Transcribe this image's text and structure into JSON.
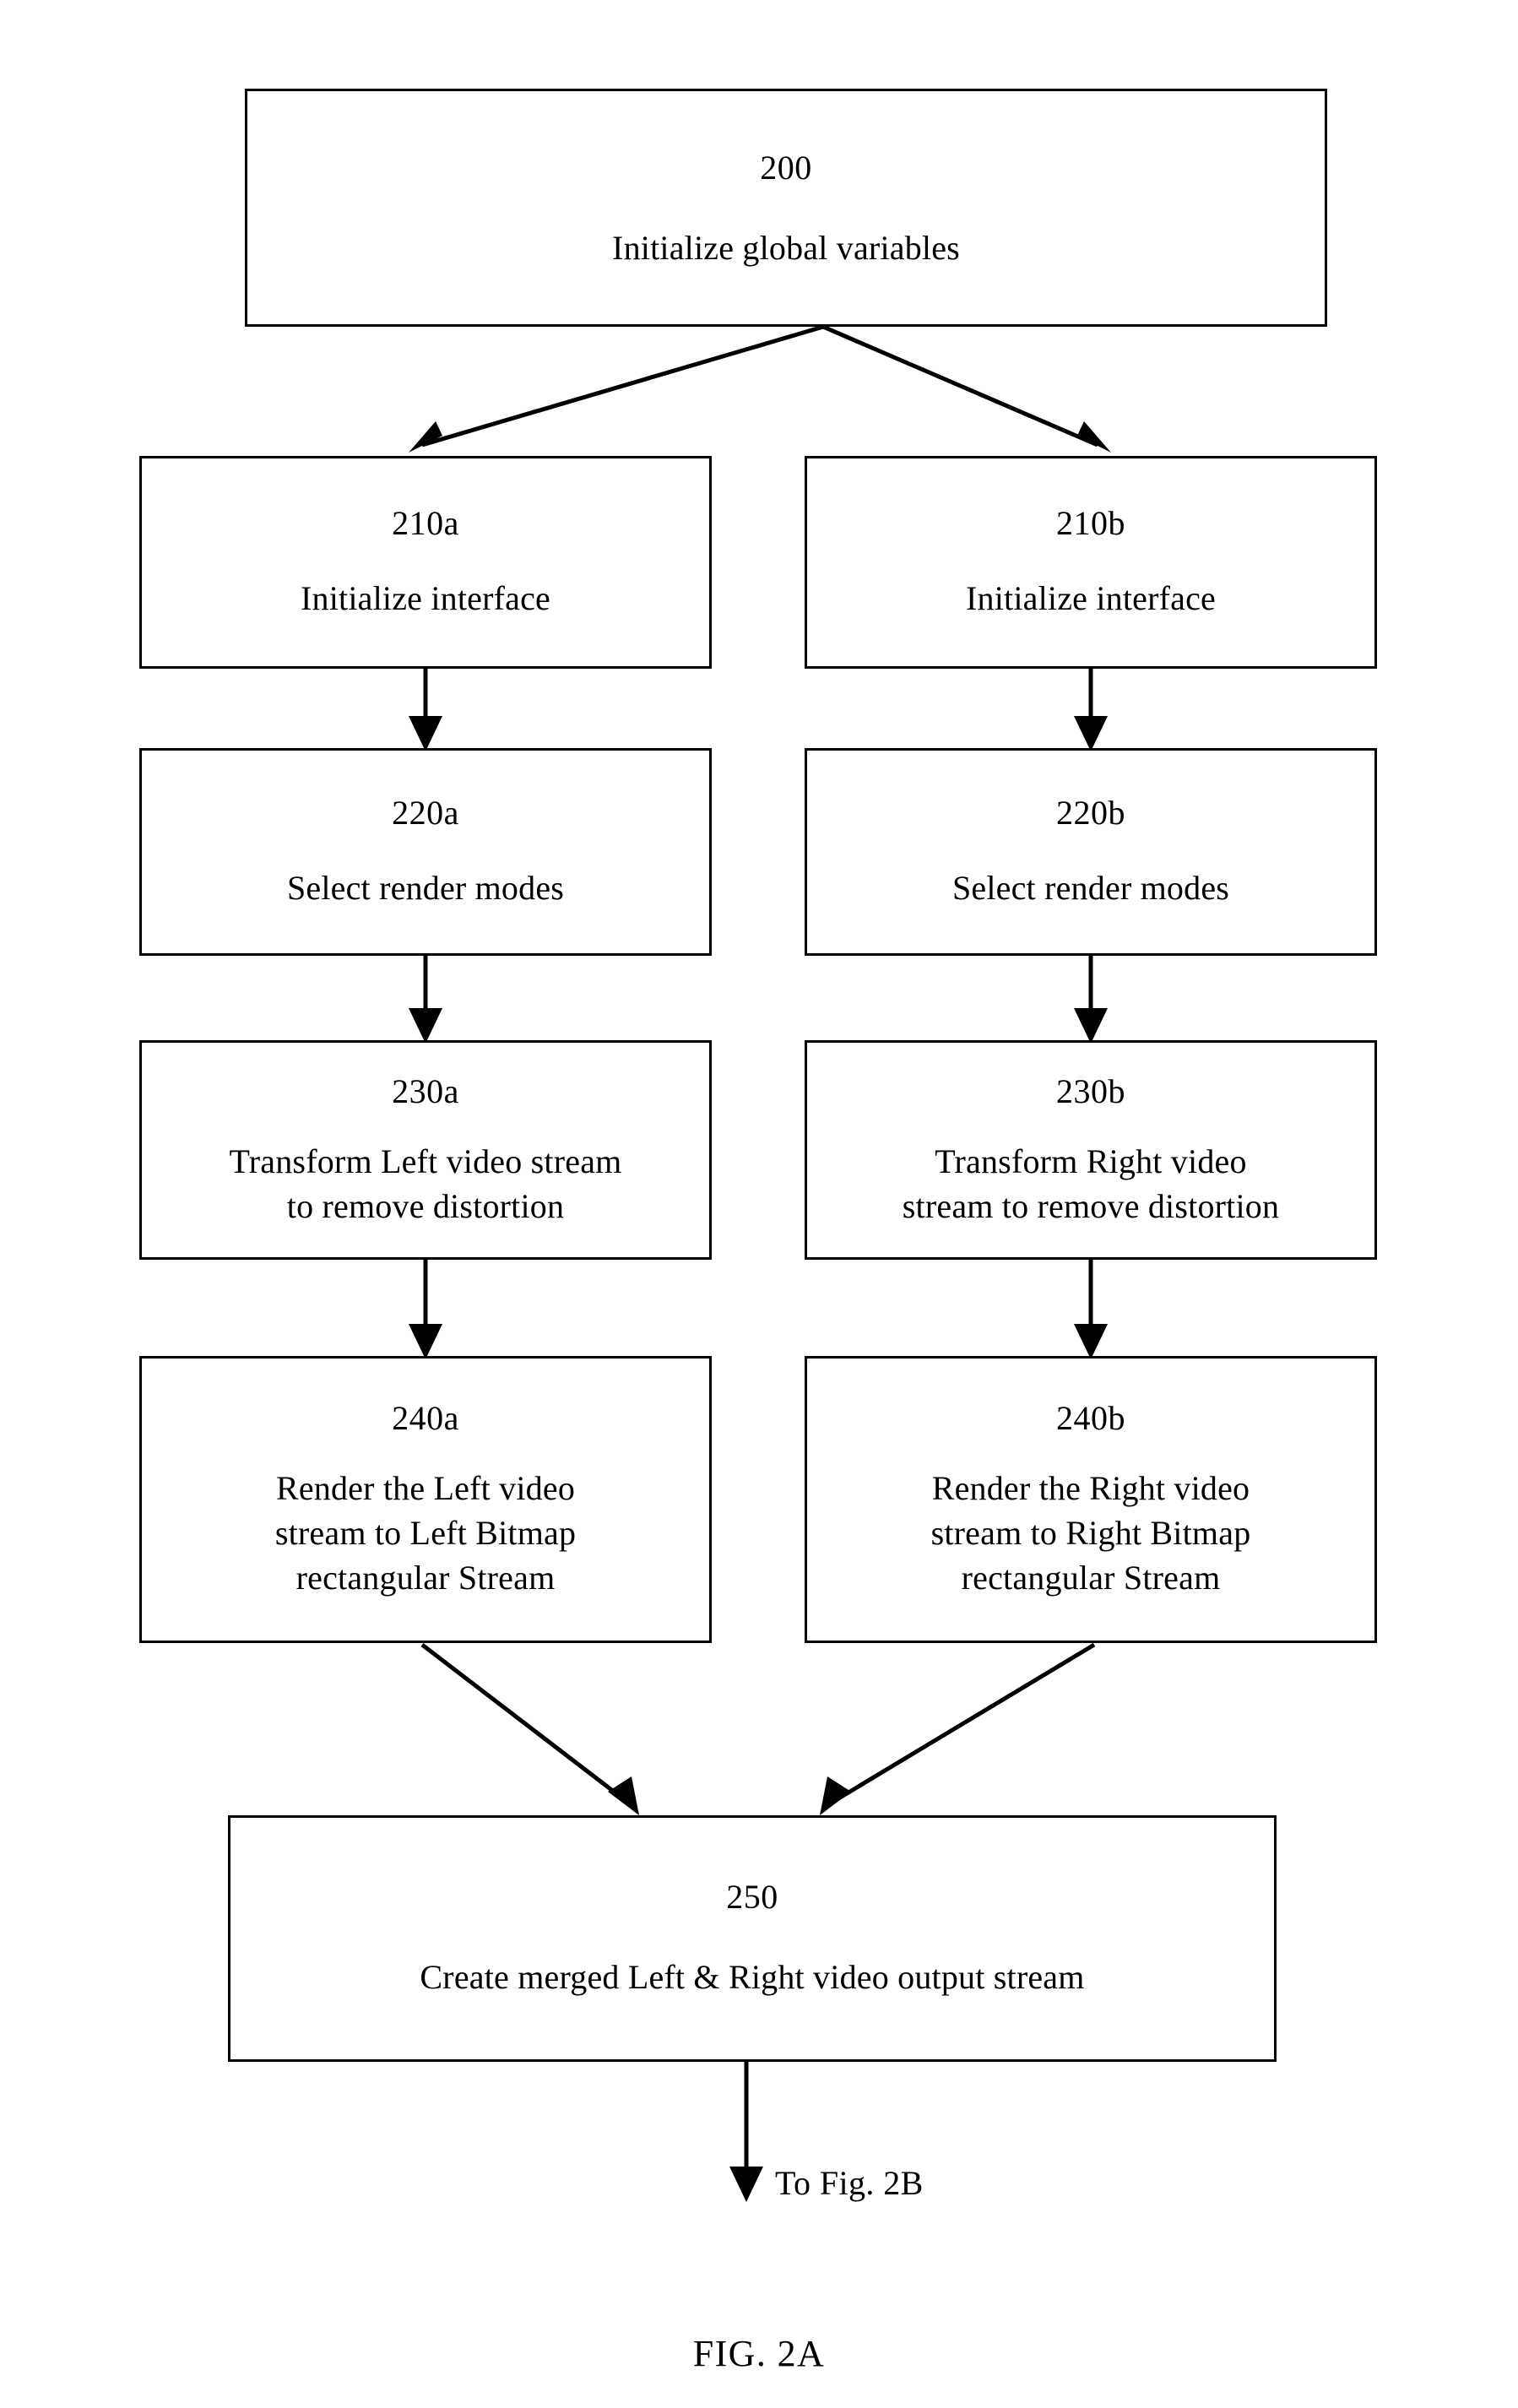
{
  "figure": {
    "caption": "FIG. 2A",
    "continuation_label": "To Fig. 2B"
  },
  "chart_data": {
    "type": "diagram",
    "subtype": "flowchart",
    "title": "FIG. 2A",
    "orientation": "top-to-bottom",
    "nodes": [
      {
        "id": "200",
        "ref": "200",
        "label": "Initialize global variables",
        "shape": "rectangle"
      },
      {
        "id": "210a",
        "ref": "210a",
        "label": "Initialize interface",
        "shape": "rectangle"
      },
      {
        "id": "210b",
        "ref": "210b",
        "label": "Initialize interface",
        "shape": "rectangle"
      },
      {
        "id": "220a",
        "ref": "220a",
        "label": "Select render modes",
        "shape": "rectangle"
      },
      {
        "id": "220b",
        "ref": "220b",
        "label": "Select render modes",
        "shape": "rectangle"
      },
      {
        "id": "230a",
        "ref": "230a",
        "label": "Transform Left video stream\nto remove distortion",
        "shape": "rectangle"
      },
      {
        "id": "230b",
        "ref": "230b",
        "label": "Transform Right video\nstream to remove distortion",
        "shape": "rectangle"
      },
      {
        "id": "240a",
        "ref": "240a",
        "label": "Render the Left video\nstream to Left Bitmap\nrectangular Stream",
        "shape": "rectangle"
      },
      {
        "id": "240b",
        "ref": "240b",
        "label": "Render the Right video\nstream to Right Bitmap\nrectangular Stream",
        "shape": "rectangle"
      },
      {
        "id": "250",
        "ref": "250",
        "label": "Create merged Left & Right video output stream",
        "shape": "rectangle"
      }
    ],
    "edges": [
      {
        "from": "200",
        "to": "210a",
        "style": "solid-arrow"
      },
      {
        "from": "200",
        "to": "210b",
        "style": "solid-arrow"
      },
      {
        "from": "210a",
        "to": "220a",
        "style": "solid-arrow"
      },
      {
        "from": "210b",
        "to": "220b",
        "style": "solid-arrow"
      },
      {
        "from": "220a",
        "to": "230a",
        "style": "solid-arrow"
      },
      {
        "from": "220b",
        "to": "230b",
        "style": "solid-arrow"
      },
      {
        "from": "230a",
        "to": "240a",
        "style": "solid-arrow"
      },
      {
        "from": "230b",
        "to": "240b",
        "style": "solid-arrow"
      },
      {
        "from": "240a",
        "to": "250",
        "style": "solid-arrow"
      },
      {
        "from": "240b",
        "to": "250",
        "style": "solid-arrow"
      },
      {
        "from": "250",
        "to": "To Fig. 2B",
        "style": "solid-arrow"
      }
    ],
    "colors": {
      "line": "#000000",
      "fill": "#ffffff",
      "text": "#000000"
    }
  },
  "nodes": {
    "n200": {
      "ref": "200",
      "label": "Initialize global variables"
    },
    "n210a": {
      "ref": "210a",
      "label": "Initialize interface"
    },
    "n210b": {
      "ref": "210b",
      "label": "Initialize interface"
    },
    "n220a": {
      "ref": "220a",
      "label": "Select render modes"
    },
    "n220b": {
      "ref": "220b",
      "label": "Select render modes"
    },
    "n230a": {
      "ref": "230a",
      "label": "Transform Left video stream\nto remove distortion"
    },
    "n230b": {
      "ref": "230b",
      "label": "Transform Right video\nstream to remove distortion"
    },
    "n240a": {
      "ref": "240a",
      "label": "Render the Left video\nstream to Left Bitmap\nrectangular Stream"
    },
    "n240b": {
      "ref": "240b",
      "label": "Render the Right video\nstream to Right Bitmap\nrectangular Stream"
    },
    "n250": {
      "ref": "250",
      "label": "Create merged Left & Right video output stream"
    }
  }
}
